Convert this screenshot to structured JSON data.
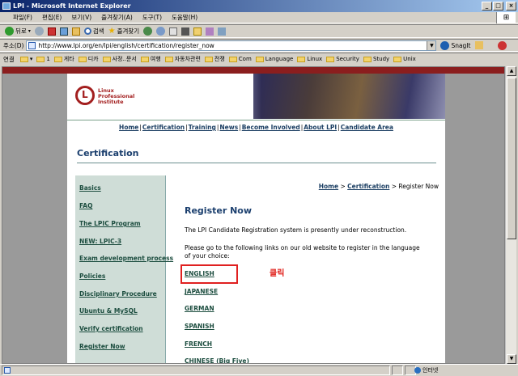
{
  "window": {
    "title": "LPI - Microsoft Internet Explorer",
    "controls": [
      "_",
      "□",
      "×"
    ]
  },
  "menu": [
    "파일(F)",
    "편집(E)",
    "보기(V)",
    "즐겨찾기(A)",
    "도구(T)",
    "도움말(H)"
  ],
  "toolbar": {
    "back": "뒤로",
    "search": "검색",
    "favorites": "즐겨찾기"
  },
  "address": {
    "label": "주소(D)",
    "url": "http://www.lpi.org/en/lpi/english/certification/register_now",
    "snagit": "SnagIt"
  },
  "links": {
    "label": "연결",
    "items": [
      "1",
      "게타",
      "디카",
      "사정..문서",
      "여행",
      "자동차관련",
      "전쟁",
      "Com",
      "Language",
      "Linux",
      "Security",
      "Study",
      "Unix"
    ]
  },
  "site": {
    "logo_text": [
      "Linux",
      "Professional",
      "Institute"
    ],
    "nav": [
      "Home",
      "Certification",
      "Training",
      "News",
      "Become Involved",
      "About LPI",
      "Candidate Area"
    ],
    "section_title": "Certification",
    "sidebar": [
      "Basics",
      "FAQ",
      "The LPIC Program",
      "NEW: LPIC-3",
      "Exam development process",
      "Policies",
      "Disciplinary Procedure",
      "Ubuntu & MySQL",
      "Verify certification",
      "Register Now"
    ],
    "breadcrumb": {
      "home": "Home",
      "sep1": ">",
      "cert": "Certification",
      "sep2": "> Register Now"
    },
    "heading": "Register Now",
    "para1": "The LPI Candidate Registration system is presently under reconstruction.",
    "para2": "Please go to the following links on our old website to register in the language of your choice:",
    "languages": [
      "ENGLISH",
      "JAPANESE",
      "GERMAN",
      "SPANISH",
      "FRENCH",
      "CHINESE (Big Five)"
    ],
    "annotation": "클릭"
  },
  "status": {
    "zone": "인터넷"
  }
}
